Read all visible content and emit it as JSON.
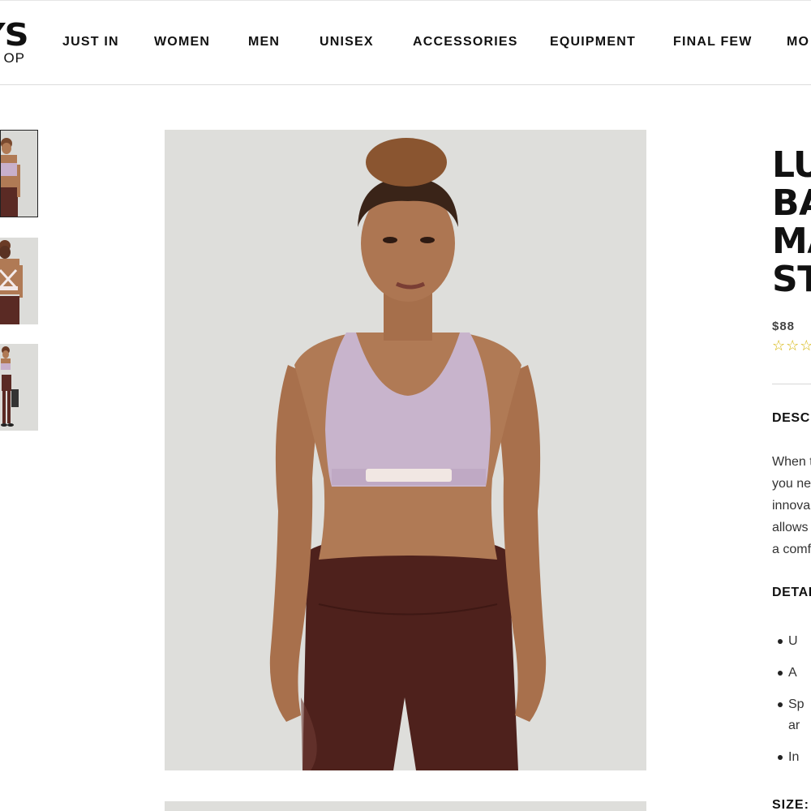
{
  "brand": {
    "logo_top": "YS",
    "logo_bottom": "OP"
  },
  "nav": [
    "JUST IN",
    "WOMEN",
    "MEN",
    "UNISEX",
    "ACCESSORIES",
    "EQUIPMENT",
    "FINAL FEW",
    "MO"
  ],
  "gallery": {
    "thumbnails": [
      "product-front-view",
      "product-back-view",
      "product-full-body-view"
    ],
    "selected_index": 0
  },
  "product": {
    "name_lines": "LU\nBA\nMA\nST",
    "price": "$88",
    "rating_stars": "☆☆☆",
    "description_heading": "DESC",
    "description_lines": [
      "When t",
      "you ne",
      "innova",
      "allows",
      "a comf"
    ],
    "details_heading": "DETAI",
    "details_items": [
      "U",
      "A",
      "Sp",
      "ar",
      "In"
    ],
    "size_label": "SIZE:"
  },
  "colors": {
    "image_bg": "#dededb",
    "star": "#d4b200",
    "text": "#111111"
  }
}
